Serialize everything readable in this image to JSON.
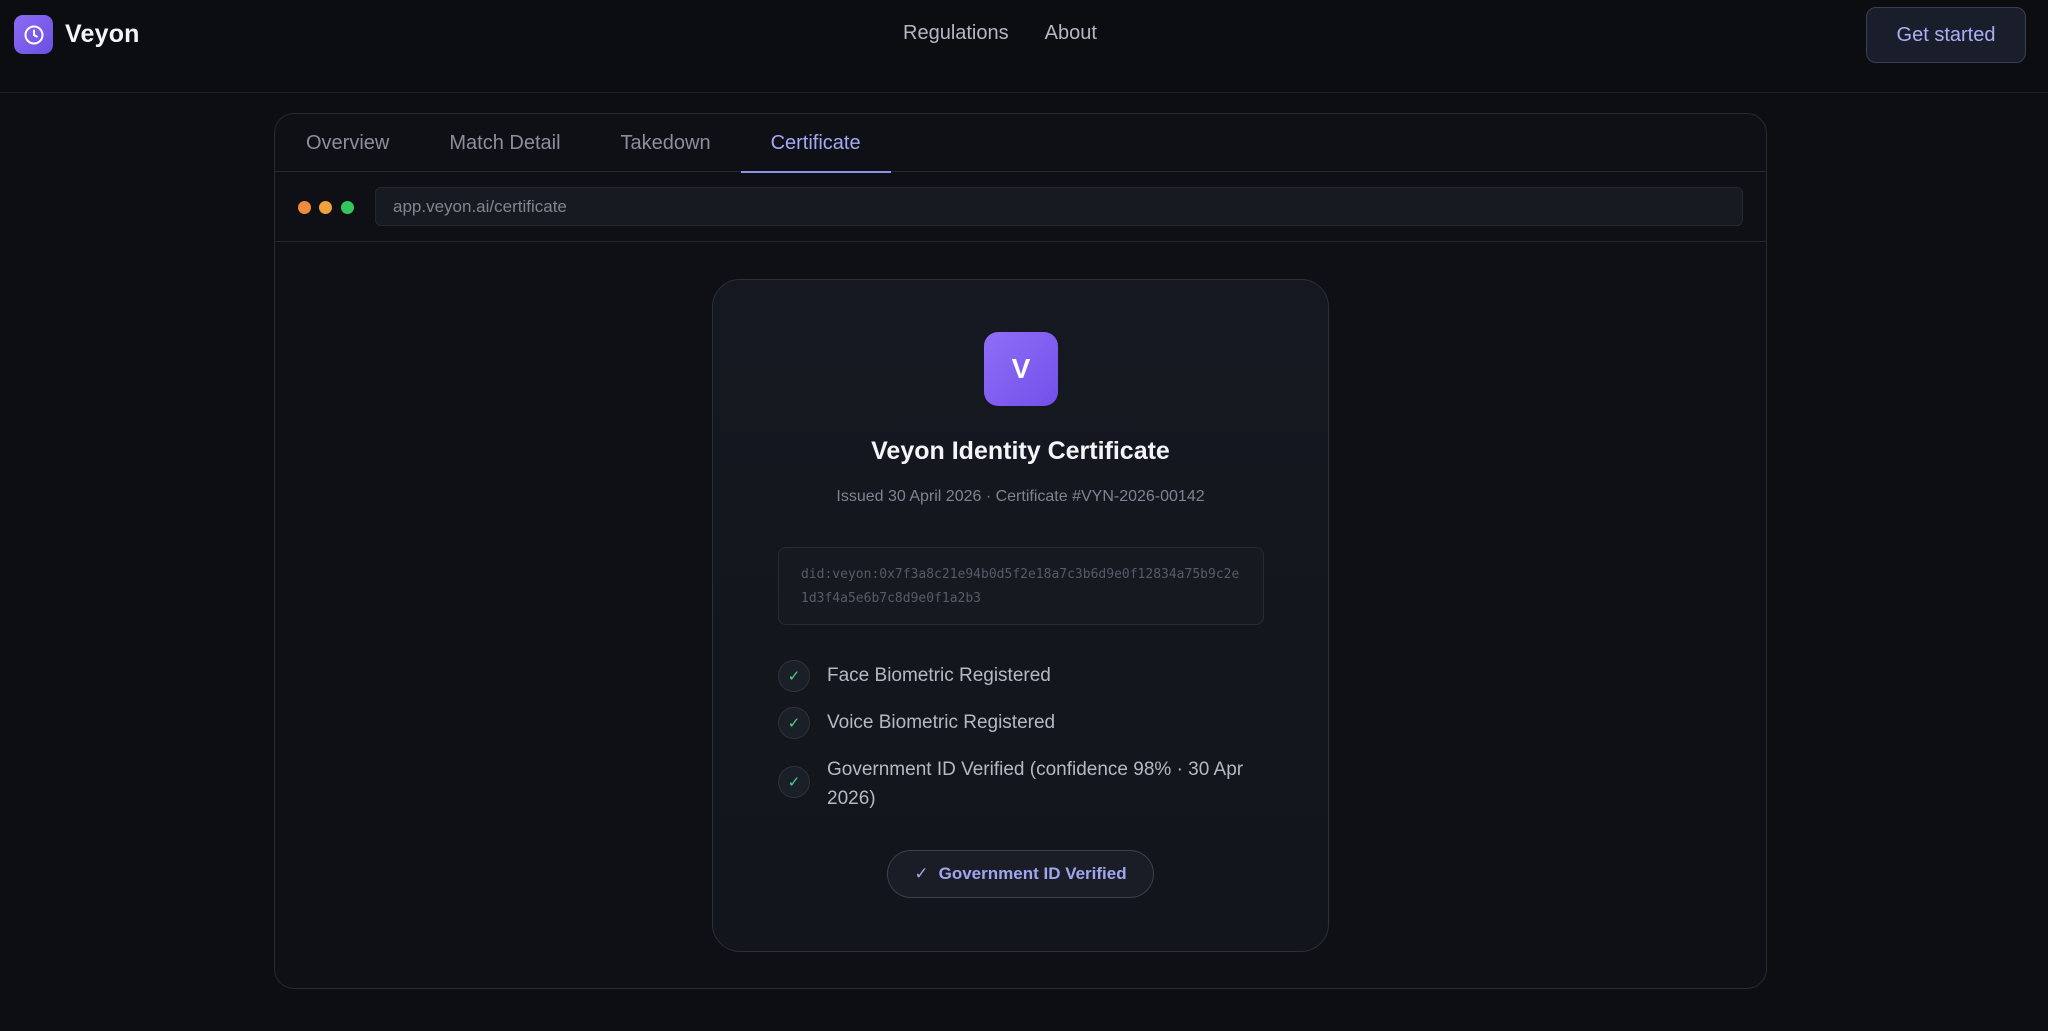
{
  "header": {
    "brand": "Veyon",
    "nav": [
      "Regulations",
      "About"
    ],
    "cta": "Get started"
  },
  "tabs": [
    {
      "label": "Overview",
      "active": false
    },
    {
      "label": "Match Detail",
      "active": false
    },
    {
      "label": "Takedown",
      "active": false
    },
    {
      "label": "Certificate",
      "active": true
    }
  ],
  "browser": {
    "url": "app.veyon.ai/certificate",
    "dot_colors": [
      "#f08a3c",
      "#f0a03c",
      "#34c759"
    ]
  },
  "certificate": {
    "logo_letter": "V",
    "title": "Veyon Identity Certificate",
    "meta": "Issued 30 April 2026  ·  Certificate #VYN-2026-00142",
    "did": "did:veyon:0x7f3a8c21e94b0d5f2e18a7c3b6d9e0f12834a75b9c2e1d3f4a5e6b7c8d9e0f1a2b3",
    "checks": [
      {
        "text": "Face Biometric Registered",
        "icon": "check-icon"
      },
      {
        "text": "Voice Biometric Registered",
        "icon": "check-icon"
      },
      {
        "text": "Government ID Verified  (confidence 98% · 30 Apr 2026)",
        "icon": "check-icon"
      }
    ],
    "badge_icon": "✓",
    "badge": "Government ID Verified"
  },
  "colors": {
    "accent": "#8d93ea",
    "logo": "#7c5cf2",
    "check": "#4ccf8f"
  }
}
